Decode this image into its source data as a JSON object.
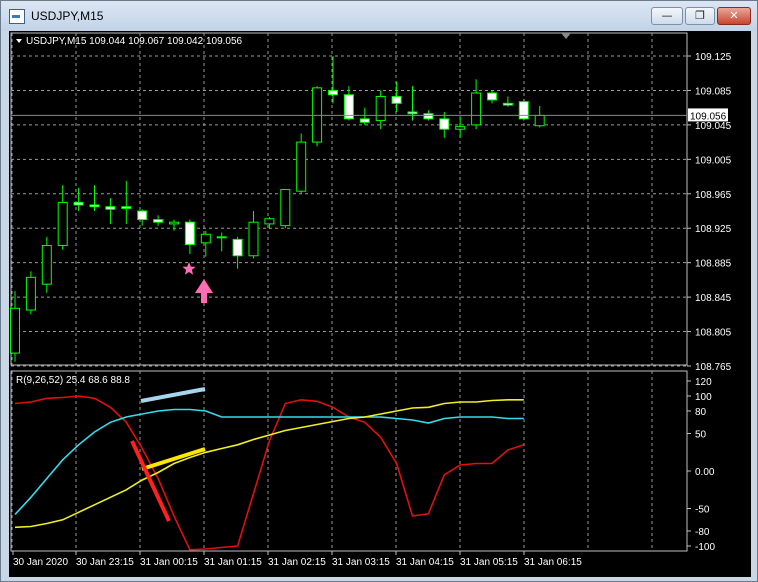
{
  "window": {
    "title": "USDJPY,M15",
    "minimize_glyph": "—",
    "maximize_glyph": "❐",
    "close_glyph": "✕"
  },
  "main": {
    "header": "USDJPY,M15  109.044 109.067 109.042 109.056",
    "price_ticks": [
      "109.125",
      "109.085",
      "109.045",
      "109.005",
      "108.965",
      "108.925",
      "108.885",
      "108.845",
      "108.805",
      "108.765"
    ],
    "current_price": "109.056",
    "colors": {
      "bull_body": "#000000",
      "bull_border": "#00ff00",
      "bear_body": "#ffffff",
      "grid": "#c0c0c0",
      "price_label_bg": "#ffffff"
    }
  },
  "indicator": {
    "header": "R(9,26,52) 25.4 68.6 88.8",
    "ticks": [
      "120",
      "100",
      "80",
      "50",
      "0.00",
      "-50",
      "-80",
      "-100"
    ],
    "series_colors": {
      "r9": "#e01010",
      "r26": "#33ddee",
      "r52": "#f0f020"
    }
  },
  "time_axis": {
    "labels": [
      "30 Jan 2020",
      "30 Jan 23:15",
      "31 Jan 00:15",
      "31 Jan 01:15",
      "31 Jan 02:15",
      "31 Jan 03:15",
      "31 Jan 04:15",
      "31 Jan 05:15",
      "31 Jan 06:15"
    ]
  },
  "annotations": {
    "star_color": "#ff6eb4",
    "arrow_color": "#ff6eb4",
    "line_colors": [
      "#a6d6ec",
      "#ffe600",
      "#ff2020"
    ]
  },
  "chart_data": {
    "type": "candlestick",
    "symbol": "USDJPY",
    "timeframe": "M15",
    "ohlc": [
      [
        108.78,
        108.852,
        108.77,
        108.832
      ],
      [
        108.83,
        108.875,
        108.825,
        108.868
      ],
      [
        108.86,
        108.915,
        108.85,
        108.905
      ],
      [
        108.905,
        108.975,
        108.9,
        108.955
      ],
      [
        108.955,
        108.972,
        108.945,
        108.952
      ],
      [
        108.952,
        108.975,
        108.945,
        108.95
      ],
      [
        108.95,
        108.96,
        108.93,
        108.947
      ],
      [
        108.95,
        108.98,
        108.93,
        108.948
      ],
      [
        108.945,
        108.947,
        108.928,
        108.935
      ],
      [
        108.935,
        108.94,
        108.928,
        108.932
      ],
      [
        108.93,
        108.935,
        108.922,
        108.932
      ],
      [
        108.932,
        108.935,
        108.895,
        108.906
      ],
      [
        108.908,
        108.922,
        108.892,
        108.918
      ],
      [
        108.915,
        108.92,
        108.898,
        108.915
      ],
      [
        108.912,
        108.915,
        108.878,
        108.893
      ],
      [
        108.893,
        108.945,
        108.89,
        108.932
      ],
      [
        108.93,
        108.938,
        108.924,
        108.936
      ],
      [
        108.928,
        108.968,
        108.925,
        108.97
      ],
      [
        108.968,
        109.035,
        108.965,
        109.025
      ],
      [
        109.025,
        109.09,
        109.02,
        109.088
      ],
      [
        109.085,
        109.125,
        109.07,
        109.08
      ],
      [
        109.08,
        109.09,
        109.05,
        109.052
      ],
      [
        109.052,
        109.065,
        109.045,
        109.048
      ],
      [
        109.05,
        109.085,
        109.04,
        109.078
      ],
      [
        109.078,
        109.095,
        109.06,
        109.07
      ],
      [
        109.06,
        109.09,
        109.05,
        109.058
      ],
      [
        109.058,
        109.062,
        109.05,
        109.052
      ],
      [
        109.052,
        109.06,
        109.03,
        109.04
      ],
      [
        109.04,
        109.055,
        109.03,
        109.043
      ],
      [
        109.045,
        109.098,
        109.04,
        109.082
      ],
      [
        109.082,
        109.085,
        109.07,
        109.074
      ],
      [
        109.07,
        109.078,
        109.066,
        109.068
      ],
      [
        109.072,
        109.075,
        109.05,
        109.052
      ],
      [
        109.044,
        109.067,
        109.042,
        109.056
      ]
    ],
    "price_range": [
      108.765,
      109.145
    ],
    "indicator": {
      "name": "R(9,26,52)",
      "current_values": [
        25.4,
        68.6,
        88.8
      ],
      "range": [
        -100,
        120
      ],
      "series": [
        {
          "name": "R(9)",
          "values": [
            90,
            92,
            97,
            98,
            100,
            97,
            85,
            65,
            30,
            -10,
            -60,
            -105,
            -104,
            -102,
            -100,
            -30,
            40,
            90,
            95,
            93,
            85,
            72,
            65,
            45,
            10,
            -60,
            -57,
            -5,
            8,
            10,
            10,
            28,
            35
          ]
        },
        {
          "name": "R(26)",
          "values": [
            -58,
            -35,
            -10,
            15,
            35,
            52,
            65,
            72,
            76,
            80,
            82,
            82,
            80,
            72,
            72,
            72,
            72,
            72,
            72,
            72,
            72,
            72,
            72,
            72,
            70,
            68,
            64,
            70,
            72,
            72,
            72,
            70,
            70
          ]
        },
        {
          "name": "R(52)",
          "values": [
            -75,
            -74,
            -70,
            -65,
            -55,
            -45,
            -35,
            -25,
            -12,
            -2,
            10,
            18,
            25,
            30,
            35,
            42,
            48,
            54,
            58,
            62,
            66,
            70,
            72,
            76,
            80,
            84,
            85,
            90,
            92,
            92,
            94,
            95,
            95
          ]
        }
      ]
    }
  }
}
